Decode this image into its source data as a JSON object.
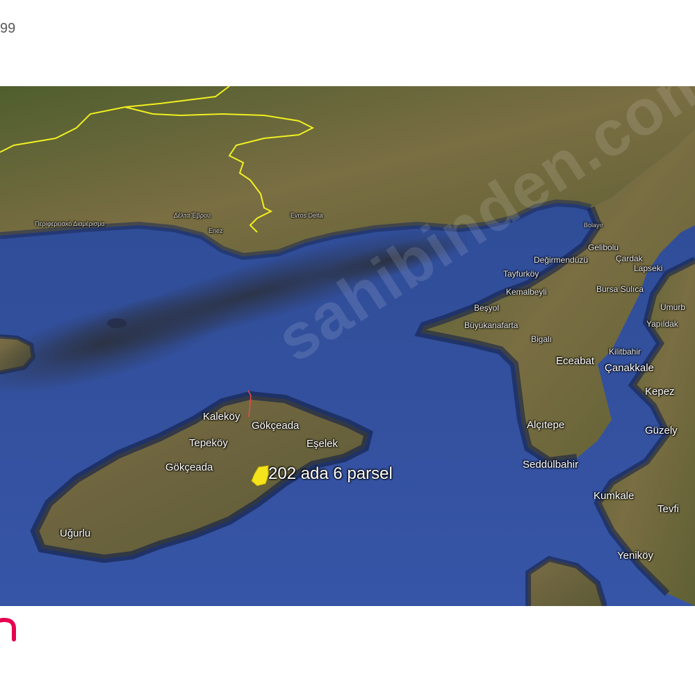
{
  "listing_code": "99",
  "watermark_text": "sahibinden.com",
  "parcel": {
    "label": "202 ada 6 parsel",
    "marker_color": "#f5e41c"
  },
  "map_labels": {
    "kalekoy": "Kaleköy",
    "gokceada_town": "Gökçeada",
    "tepekoy": "Tepeköy",
    "eselek": "Eşelek",
    "gokceada_island": "Gökçeada",
    "ugurlu": "Uğurlu",
    "alcitepe": "Alçıtepe",
    "seddulbahir": "Seddülbahir",
    "kumkale": "Kumkale",
    "tevfikiye": "Tevfi",
    "yenikoy": "Yeniköy",
    "guzelyali": "Güzely",
    "kepez": "Kepez",
    "eceabat": "Eceabat",
    "canakkale": "Çanakkale",
    "kilitbahir": "Kilitbahir",
    "bigali": "Bigalı",
    "buyukanafarta": "Büyükanafarta",
    "besyol": "Beşyol",
    "kemalbeyli": "Kemalbeyli",
    "tayfurkoy": "Tayfurköy",
    "degirmenduzu": "Değirmendüzü",
    "gelibolu": "Gelibolu",
    "bolayir": "Bolayır",
    "cardak": "Çardak",
    "lapseki": "Lapseki",
    "bursasulica": "Bursa Sulıca",
    "umurbey": "Umurb",
    "yapildak": "Yapıldak",
    "evros_delta": "Evros Delta",
    "vakos": "Δέλτα Έβρου",
    "saros_coast": "Περιφερειακό Διαμέρισμα",
    "enez": "Enez"
  },
  "colors": {
    "sea": "#2e4d9a",
    "land": "#6e6a3e",
    "border": "#f0f020",
    "brand": "#e6004f"
  }
}
